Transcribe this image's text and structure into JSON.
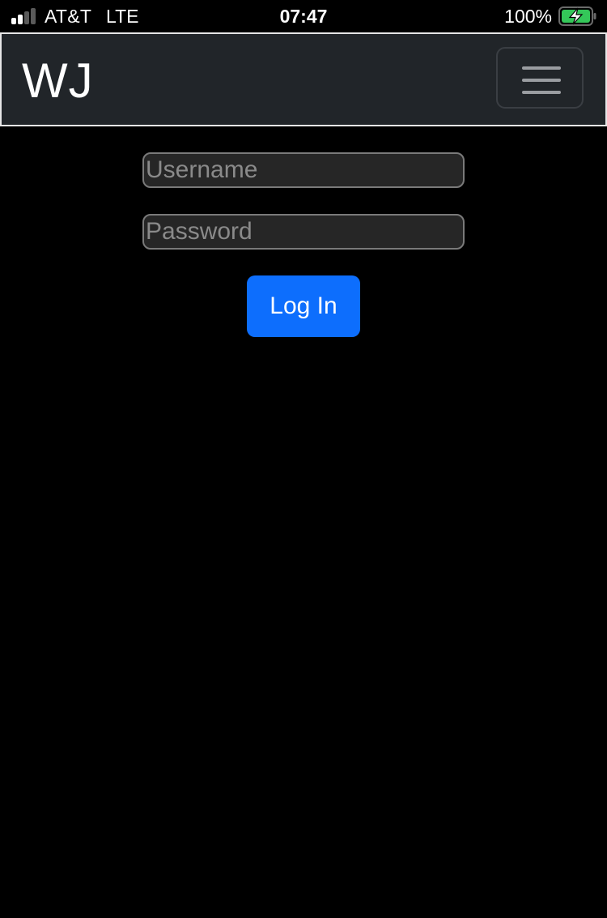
{
  "status_bar": {
    "carrier": "AT&T",
    "network": "LTE",
    "time": "07:47",
    "battery_percent": "100%",
    "signal_bars": 4,
    "signal_bars_filled": 2,
    "charging": true,
    "battery_color": "#34c759"
  },
  "navbar": {
    "brand": "WJ",
    "menu_icon": "hamburger-icon",
    "background": "#212529"
  },
  "login_form": {
    "username": {
      "value": "",
      "placeholder": "Username"
    },
    "password": {
      "value": "",
      "placeholder": "Password"
    },
    "submit_label": "Log In",
    "submit_color": "#0d6efd"
  }
}
